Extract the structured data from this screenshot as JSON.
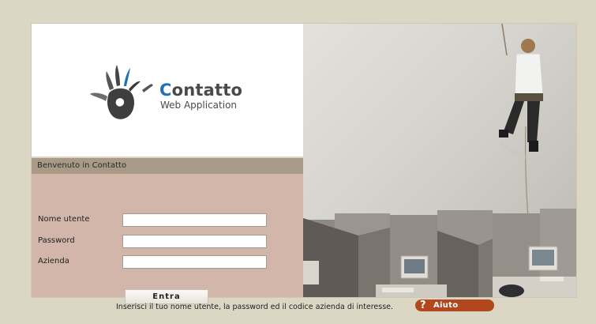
{
  "brand": {
    "title_cap": "C",
    "title_rest": "ontatto",
    "subtitle": "Web Application"
  },
  "welcome": "Benvenuto in Contatto",
  "form": {
    "username_label": "Nome utente",
    "username_value": "",
    "password_label": "Password",
    "password_value": "",
    "company_label": "Azienda",
    "company_value": "",
    "submit_label": "Entra"
  },
  "footer": {
    "hint": "Inserisci il tuo nome utente, la password ed il codice azienda di interesse.",
    "help_label": "Aiuto",
    "help_glyph": "?"
  },
  "colors": {
    "background": "#dcd6c4",
    "welcome_bar": "#a89a86",
    "form_bg": "#d2b6a9",
    "brand_accent": "#1f6fb6",
    "help_button": "#b2461c"
  }
}
